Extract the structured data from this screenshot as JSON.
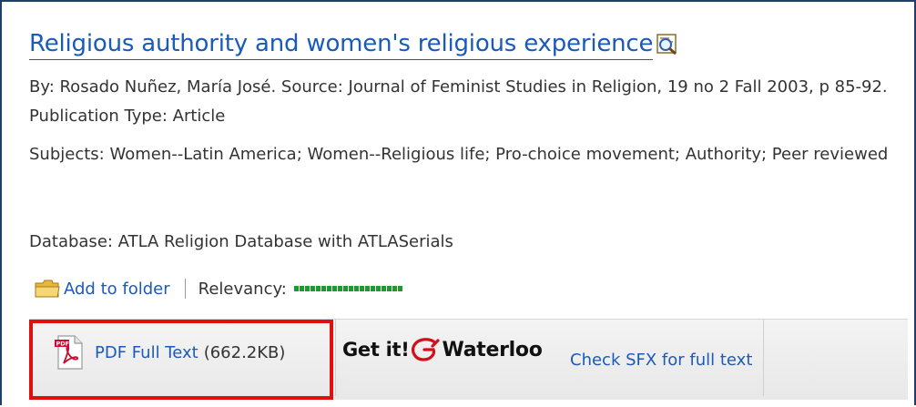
{
  "record": {
    "title": "Religious authority and women's religious experience",
    "by_line": "By: Rosado Nuñez, María José. Source: Journal of Feminist Studies in Religion, 19 no 2 Fall 2003, p 85-92. Publication Type: Article",
    "subjects_line": "Subjects: Women--Latin America; Women--Religious life; Pro-choice movement; Authority; Peer reviewed",
    "database_line": "Database: ATLA Religion Database with ATLASerials"
  },
  "actions": {
    "add_to_folder": "Add to folder",
    "relevancy_label": "Relevancy:",
    "relevancy_level": 1.0
  },
  "links": {
    "pdf_label": "PDF Full Text",
    "pdf_size": "(662.2KB)",
    "getit_label": "Get it!",
    "waterloo_label": "Waterloo",
    "sfx_label": "Check SFX for full text"
  },
  "icons": {
    "preview": "magnifier-preview-icon",
    "folder": "folder-icon",
    "pdf": "pdf-icon",
    "swirl": "waterloo-swirl-icon"
  },
  "colors": {
    "link": "#1a5ab8",
    "highlight_border": "#e01010",
    "relevancy": "#1f9a2a",
    "frame": "#1f3f6b"
  }
}
